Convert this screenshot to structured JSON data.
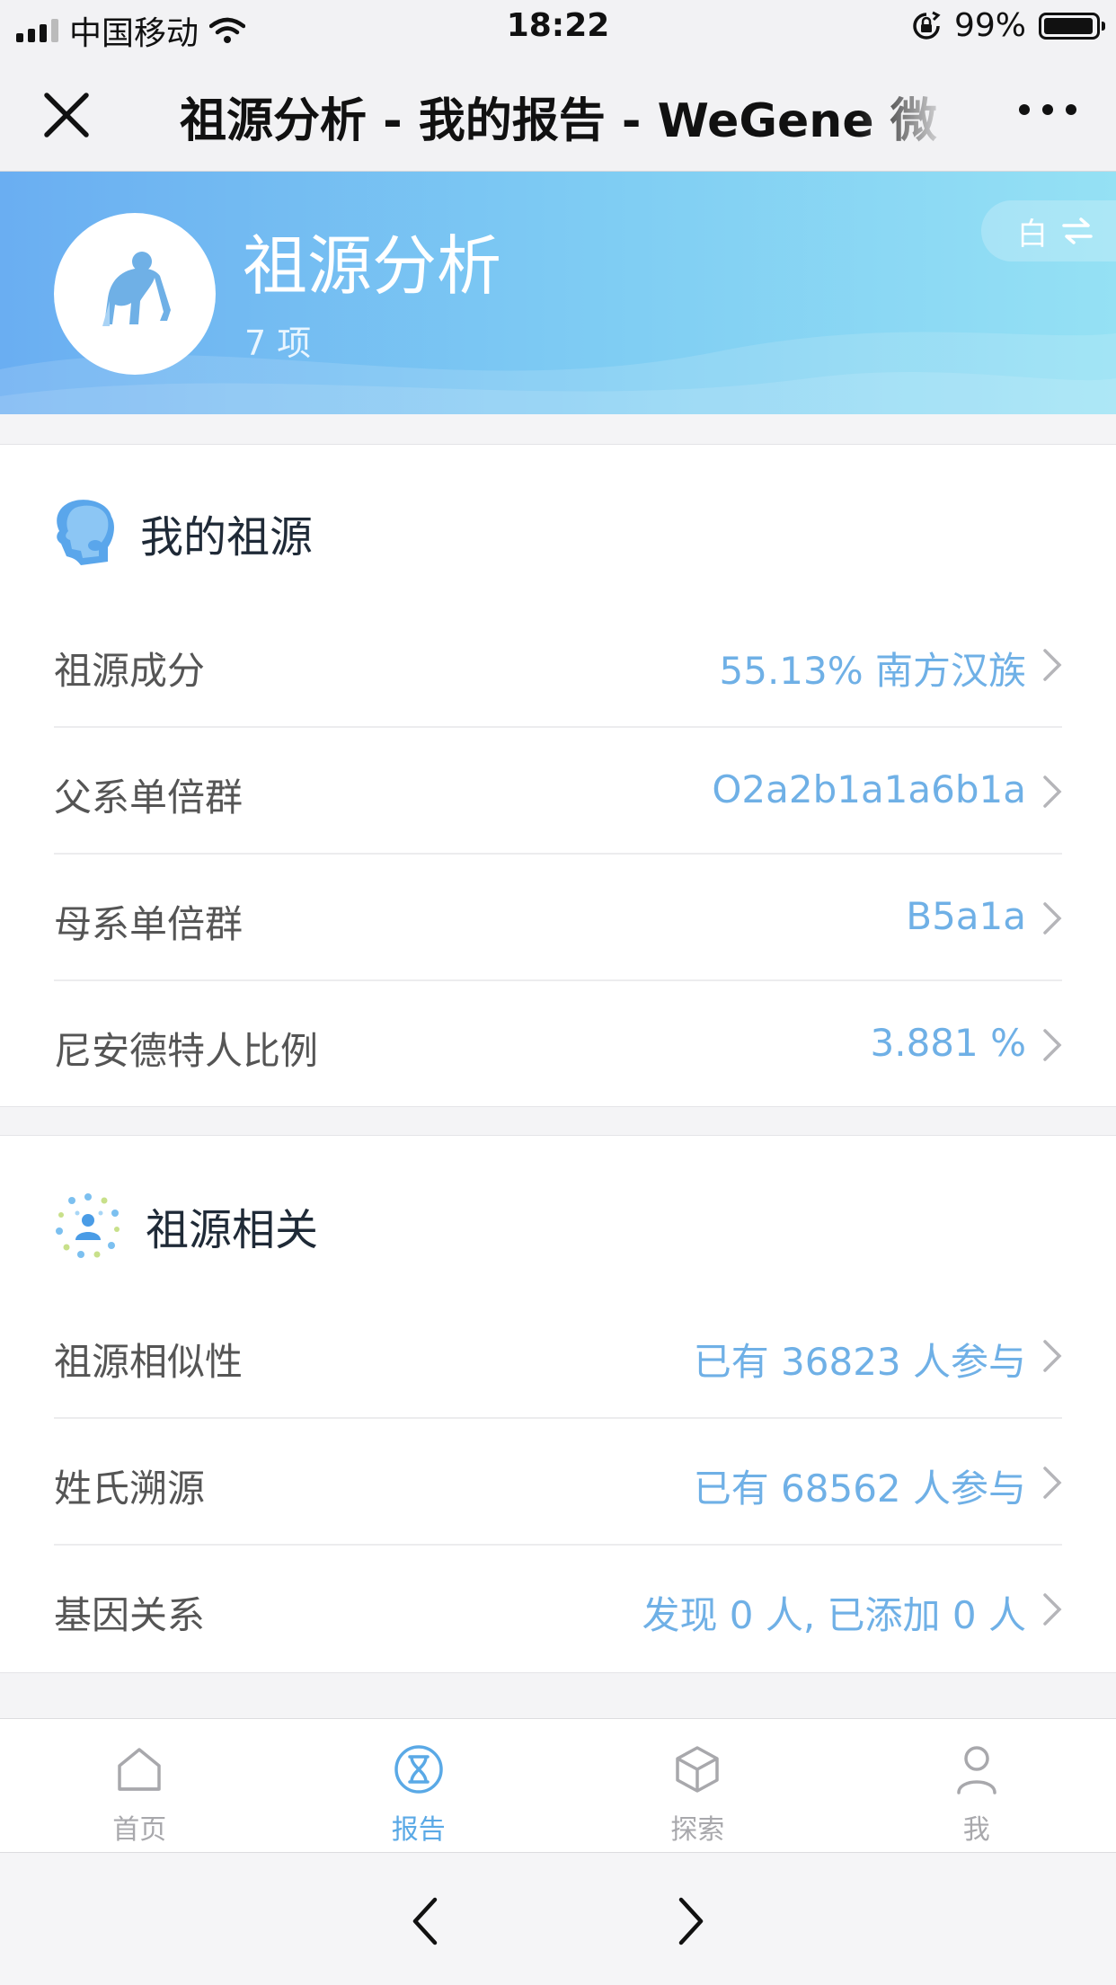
{
  "status_bar": {
    "carrier": "中国移动",
    "time": "18:22",
    "battery": "99%",
    "battery_level": 0.99
  },
  "nav": {
    "title": "祖源分析 - 我的报告 - WeGene 微"
  },
  "banner": {
    "title": "祖源分析",
    "count": "7 项",
    "theme_label": "白",
    "colors": {
      "start": "#6aaef2",
      "end": "#95e1f4"
    }
  },
  "sections": [
    {
      "title": "我的祖源",
      "icon": "ancestry-face-icon",
      "rows": [
        {
          "label": "祖源成分",
          "value": "55.13% 南方汉族"
        },
        {
          "label": "父系单倍群",
          "value": "O2a2b1a1a6b1a"
        },
        {
          "label": "母系单倍群",
          "value": "B5a1a"
        },
        {
          "label": "尼安德特人比例",
          "value": "3.881 %"
        }
      ]
    },
    {
      "title": "祖源相关",
      "icon": "network-people-icon",
      "rows": [
        {
          "label": "祖源相似性",
          "value": "已有 36823 人参与"
        },
        {
          "label": "姓氏溯源",
          "value": "已有 68562 人参与"
        },
        {
          "label": "基因关系",
          "value": "发现 0 人, 已添加 0 人"
        }
      ]
    }
  ],
  "tabs": [
    {
      "label": "首页",
      "icon": "home-icon"
    },
    {
      "label": "报告",
      "icon": "dna-icon",
      "active": true
    },
    {
      "label": "探索",
      "icon": "cube-icon"
    },
    {
      "label": "我",
      "icon": "person-icon"
    }
  ],
  "accent_color": "#6fb0e6"
}
